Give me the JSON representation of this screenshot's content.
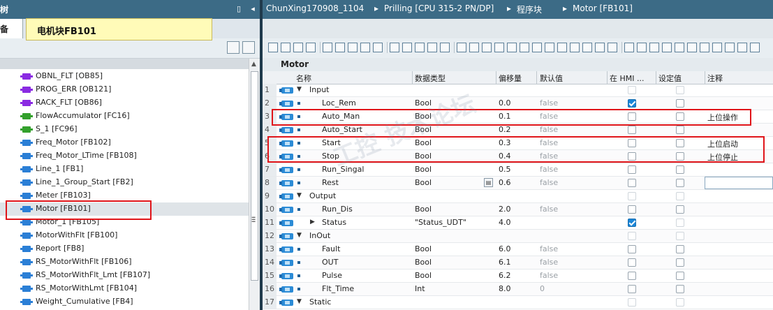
{
  "left_panel": {
    "title": "树",
    "tab_label": "备",
    "callout": "电机块FB101",
    "tree_items": [
      {
        "label": "OBNL_FLT [OB85]",
        "color": "#8a2be2"
      },
      {
        "label": "PROG_ERR [OB121]",
        "color": "#8a2be2"
      },
      {
        "label": "RACK_FLT [OB86]",
        "color": "#8a2be2"
      },
      {
        "label": "FlowAccumulator [FC16]",
        "color": "#33a02c"
      },
      {
        "label": "S_1 [FC96]",
        "color": "#33a02c"
      },
      {
        "label": "Freq_Motor [FB102]",
        "color": "#2b7fd6"
      },
      {
        "label": "Freq_Motor_LTime [FB108]",
        "color": "#2b7fd6"
      },
      {
        "label": "Line_1 [FB1]",
        "color": "#2b7fd6"
      },
      {
        "label": "Line_1_Group_Start [FB2]",
        "color": "#2b7fd6"
      },
      {
        "label": "Meter [FB103]",
        "color": "#2b7fd6"
      },
      {
        "label": "Motor [FB101]",
        "color": "#2b7fd6"
      },
      {
        "label": "Motor_1 [FB105]",
        "color": "#2b7fd6"
      },
      {
        "label": "MotorWithFlt [FB100]",
        "color": "#2b7fd6"
      },
      {
        "label": "Report [FB8]",
        "color": "#2b7fd6"
      },
      {
        "label": "RS_MotorWithFlt [FB106]",
        "color": "#2b7fd6"
      },
      {
        "label": "RS_MotorWithFlt_Lmt [FB107]",
        "color": "#2b7fd6"
      },
      {
        "label": "RS_MotorWithLmt [FB104]",
        "color": "#2b7fd6"
      },
      {
        "label": "Weight_Cumulative [FB4]",
        "color": "#2b7fd6"
      }
    ]
  },
  "breadcrumb": {
    "project": "ChunXing170908_1104",
    "device": "Prilling [CPU 315-2 PN/DP]",
    "folder": "程序块",
    "block": "Motor [FB101]"
  },
  "editor": {
    "block_title": "Motor",
    "columns": {
      "name": "名称",
      "datatype": "数据类型",
      "offset": "偏移量",
      "default": "默认值",
      "hmi": "在 HMI ...",
      "setpoint": "设定值",
      "comment": "注释"
    },
    "rows": [
      {
        "num": "1",
        "section": true,
        "expanded": true,
        "name": "Input",
        "type": "",
        "offset": "",
        "default": "",
        "hmi": false,
        "comment": ""
      },
      {
        "num": "2",
        "name": "Loc_Rem",
        "type": "Bool",
        "offset": "0.0",
        "default": "false",
        "hmi": true,
        "comment": ""
      },
      {
        "num": "3",
        "name": "Auto_Man",
        "type": "Bool",
        "offset": "0.1",
        "default": "false",
        "hmi": false,
        "comment": "上位操作"
      },
      {
        "num": "4",
        "name": "Auto_Start",
        "type": "Bool",
        "offset": "0.2",
        "default": "false",
        "hmi": false,
        "comment": ""
      },
      {
        "num": "5",
        "name": "Start",
        "type": "Bool",
        "offset": "0.3",
        "default": "false",
        "hmi": false,
        "comment": "上位启动"
      },
      {
        "num": "6",
        "name": "Stop",
        "type": "Bool",
        "offset": "0.4",
        "default": "false",
        "hmi": false,
        "comment": "上位停止"
      },
      {
        "num": "7",
        "name": "Run_Singal",
        "type": "Bool",
        "offset": "0.5",
        "default": "false",
        "hmi": false,
        "comment": ""
      },
      {
        "num": "8",
        "name": "Rest",
        "type": "Bool",
        "offset": "0.6",
        "default": "false",
        "hmi": false,
        "comment": "",
        "editing": true
      },
      {
        "num": "9",
        "section": true,
        "expanded": true,
        "name": "Output",
        "type": "",
        "offset": "",
        "default": "",
        "hmi": false,
        "comment": ""
      },
      {
        "num": "10",
        "name": "Run_Dis",
        "type": "Bool",
        "offset": "2.0",
        "default": "false",
        "hmi": false,
        "comment": ""
      },
      {
        "num": "11",
        "name": "Status",
        "struct": true,
        "type": "\"Status_UDT\"",
        "offset": "4.0",
        "default": "",
        "hmi": true,
        "comment": ""
      },
      {
        "num": "12",
        "section": true,
        "expanded": true,
        "name": "InOut",
        "type": "",
        "offset": "",
        "default": "",
        "hmi": false,
        "comment": ""
      },
      {
        "num": "13",
        "name": "Fault",
        "type": "Bool",
        "offset": "6.0",
        "default": "false",
        "hmi": false,
        "comment": ""
      },
      {
        "num": "14",
        "name": "OUT",
        "type": "Bool",
        "offset": "6.1",
        "default": "false",
        "hmi": false,
        "comment": ""
      },
      {
        "num": "15",
        "name": "Pulse",
        "type": "Bool",
        "offset": "6.2",
        "default": "false",
        "hmi": false,
        "comment": ""
      },
      {
        "num": "16",
        "name": "Flt_Time",
        "type": "Int",
        "offset": "8.0",
        "default": "0",
        "hmi": false,
        "comment": ""
      },
      {
        "num": "17",
        "section": true,
        "expanded": true,
        "name": "Static",
        "type": "",
        "offset": "",
        "default": "",
        "hmi": false,
        "comment": ""
      }
    ]
  },
  "colors": {
    "title_bar": "#3c6b86",
    "highlight_box": "#e0151a",
    "callout_bg": "#fffbb8",
    "checkbox_on": "#1a86d8"
  }
}
